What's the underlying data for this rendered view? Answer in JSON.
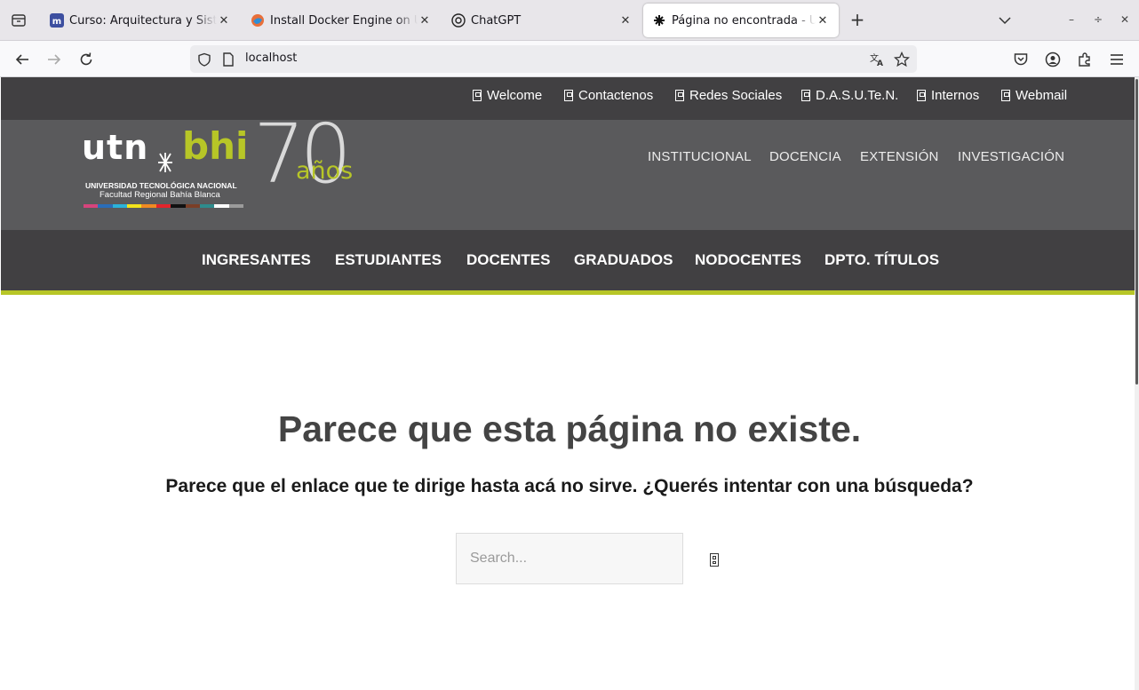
{
  "browser": {
    "tabs": [
      {
        "title": "Curso: Arquitectura y Sistemas Operativos",
        "active": false
      },
      {
        "title": "Install Docker Engine on Ubuntu",
        "active": false
      },
      {
        "title": "ChatGPT",
        "active": false
      },
      {
        "title": "Página no encontrada - UTN FRBB",
        "active": true
      }
    ],
    "url": "localhost",
    "new_tab": "+",
    "window_controls": {
      "minimize": "–",
      "restore": "÷",
      "close": "✕"
    }
  },
  "topbar": {
    "links": [
      "Welcome",
      "Contactenos",
      "Redes Sociales",
      "D.A.S.U.Te.N.",
      "Internos",
      "Webmail"
    ]
  },
  "logo": {
    "wordmark_left": "utn",
    "wordmark_right": "bhi",
    "line1": "UNIVERSIDAD TECNOLÓGICA NACIONAL",
    "line2": "Facultad Regional Bahía Blanca",
    "anniversary_number": "70",
    "anniversary_word": "años",
    "stripe_colors": [
      "#d6447c",
      "#2a6db8",
      "#2bb2d9",
      "#f3e31b",
      "#f08a22",
      "#e2242b",
      "#111111",
      "#7b3f27",
      "#2e8c8d",
      "#ffffff",
      "#9b9b9b"
    ]
  },
  "mainnav": {
    "links": [
      "INSTITUCIONAL",
      "DOCENCIA",
      "EXTENSIÓN",
      "INVESTIGACIÓN"
    ]
  },
  "menu": {
    "links": [
      "INGRESANTES",
      "ESTUDIANTES",
      "DOCENTES",
      "GRADUADOS",
      "NODOCENTES",
      "DPTO. TÍTULOS"
    ]
  },
  "content": {
    "title": "Parece que esta página no existe.",
    "subtitle": "Parece que el enlace que te dirige hasta acá no sirve. ¿Querés intentar con una búsqueda?",
    "search_placeholder": "Search..."
  },
  "colors": {
    "accent_green": "#b7c627",
    "dark_gray": "#414042",
    "header_gray": "#5a5a5c"
  }
}
